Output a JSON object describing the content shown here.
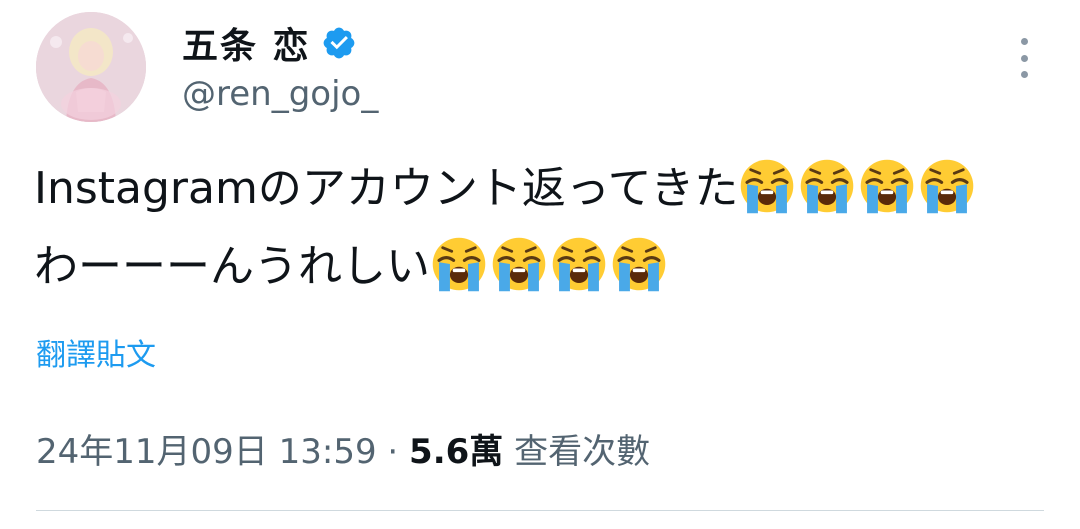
{
  "author": {
    "display_name": "五条 恋",
    "handle": "@ren_gojo_",
    "verified": true,
    "avatar_icon": "profile-photo-icon"
  },
  "tweet": {
    "line1_text": "Instagramのアカウント返ってきた",
    "line1_emoji_count": 4,
    "line2_text": "わーーーんうれしい",
    "line2_emoji_count": 4,
    "emoji_icon": "loudly-crying-face-icon"
  },
  "translate_label": "翻譯貼文",
  "meta": {
    "timestamp": "24年11月09日 13:59",
    "separator": " · ",
    "views_count": "5.6萬",
    "views_label": " 查看次數"
  },
  "colors": {
    "link": "#1d9bf0",
    "muted": "#536471",
    "text": "#0f1419"
  }
}
